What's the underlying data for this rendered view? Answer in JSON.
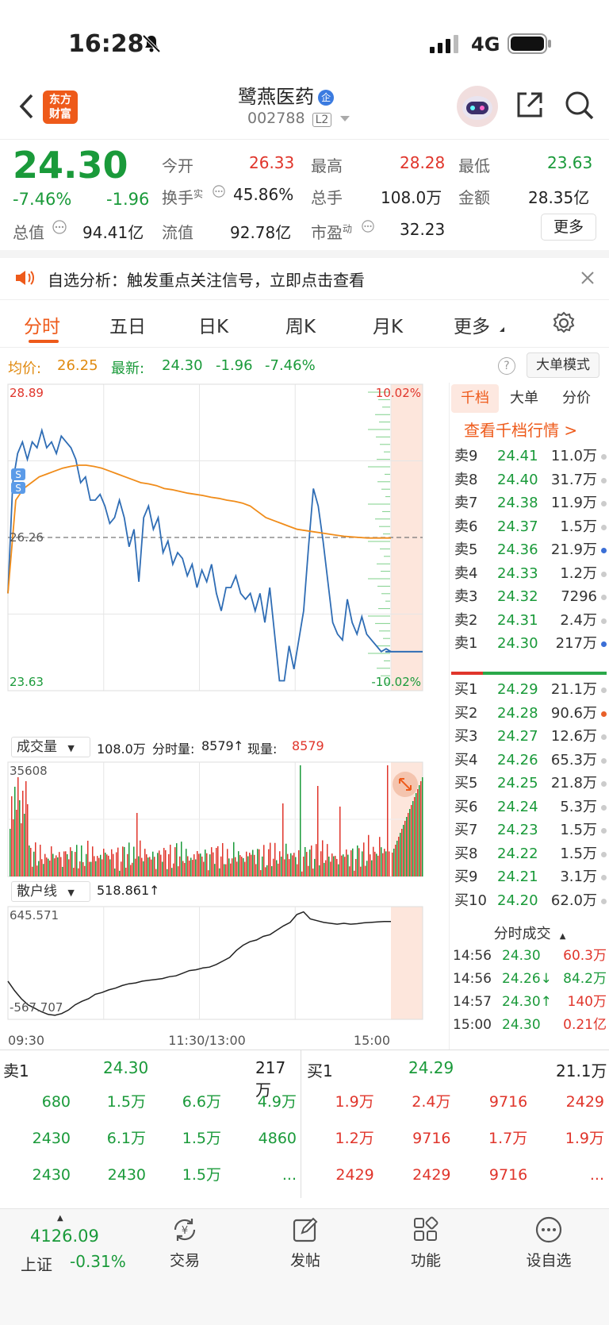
{
  "status_bar": {
    "time": "16:28",
    "network": "4G"
  },
  "header": {
    "logo_line1": "东方",
    "logo_line2": "财富",
    "stock_name": "鹭燕医药",
    "enterprise_badge": "企",
    "stock_code": "002788",
    "level": "L2"
  },
  "quote": {
    "price": "24.30",
    "change_pct": "-7.46%",
    "change": "-1.96",
    "open_label": "今开",
    "open": "26.33",
    "high_label": "最高",
    "high": "28.28",
    "low_label": "最低",
    "low": "23.63",
    "turnover_label": "换手",
    "turnover_sup": "实",
    "turnover": "45.86%",
    "volume_label": "总手",
    "volume": "108.0万",
    "amount_label": "金额",
    "amount": "28.35亿",
    "mktcap_label": "总值",
    "mktcap": "94.41亿",
    "float_label": "流值",
    "float": "92.78亿",
    "pe_label": "市盈",
    "pe_sup": "动",
    "pe": "32.23",
    "more_button": "更多"
  },
  "notice": {
    "text": "自选分析：触发重点关注信号，立即点击查看"
  },
  "tabs": [
    "分时",
    "五日",
    "日K",
    "周K",
    "月K",
    "更多"
  ],
  "active_tab": 0,
  "info_line": {
    "avg_label": "均价:",
    "avg": "26.25",
    "last_label": "最新:",
    "last": "24.30",
    "change": "-1.96",
    "change_pct": "-7.46%",
    "mode_button": "大单模式"
  },
  "chart_data": [
    {
      "type": "line",
      "title": "分时",
      "y_top_label": "28.89",
      "y_bottom_label": "23.63",
      "y_mid_label": "26.26",
      "pct_top_label": "10.02%",
      "pct_bottom_label": "-10.02%",
      "ylim": [
        23.63,
        28.89
      ],
      "reference_price": 26.26,
      "x_labels": [
        "09:30",
        "11:30/13:00",
        "15:00"
      ],
      "series": [
        {
          "name": "",
          "color": "#2f6db5",
          "values": [
            25.3,
            27.2,
            27.7,
            27.9,
            27.6,
            27.9,
            27.8,
            28.1,
            27.8,
            27.9,
            27.7,
            28.0,
            27.9,
            27.8,
            27.6,
            27.2,
            27.3,
            26.9,
            26.9,
            27.0,
            26.8,
            26.5,
            26.6,
            26.9,
            26.6,
            26.1,
            26.4,
            25.5,
            26.6,
            26.8,
            26.4,
            26.6,
            26.0,
            26.2,
            25.8,
            26.0,
            25.9,
            25.6,
            25.8,
            25.4,
            25.7,
            25.5,
            25.8,
            25.3,
            25.0,
            25.4,
            25.4,
            25.6,
            25.3,
            25.2,
            25.3,
            25.0,
            25.3,
            24.8,
            25.4,
            24.6,
            23.8,
            23.8,
            24.4,
            24.0,
            24.5,
            25.0,
            26.1,
            27.1,
            26.8,
            26.2,
            25.5,
            24.8,
            24.6,
            24.5,
            25.2,
            24.8,
            24.6,
            24.9,
            24.6,
            24.5,
            24.4,
            24.3,
            24.35,
            24.3
          ]
        },
        {
          "name": "",
          "color": "#f08c1a",
          "values": [
            25.3,
            26.9,
            27.1,
            27.2,
            27.3,
            27.35,
            27.4,
            27.45,
            27.48,
            27.5,
            27.5,
            27.48,
            27.45,
            27.4,
            27.35,
            27.3,
            27.25,
            27.2,
            27.18,
            27.15,
            27.1,
            27.08,
            27.05,
            27.02,
            27.0,
            26.98,
            26.95,
            26.93,
            26.9,
            26.88,
            26.85,
            26.8,
            26.7,
            26.6,
            26.55,
            26.5,
            26.45,
            26.4,
            26.38,
            26.36,
            26.34,
            26.32,
            26.3,
            26.28,
            26.27,
            26.26,
            26.25,
            26.25,
            26.25,
            26.25
          ]
        }
      ]
    },
    {
      "type": "bar",
      "title": "成交量",
      "summary": "108.0万",
      "minute_label": "分时量:",
      "minute_value": "8579",
      "current_label": "现量:",
      "current_value": "8579",
      "ymax_label": "35608"
    },
    {
      "type": "line",
      "title": "散户线",
      "summary": "518.861",
      "ymax_label": "645.571",
      "ymin_label": "-567.707",
      "ylim": [
        -567.707,
        645.571
      ],
      "series": [
        {
          "name": "",
          "color": "#222",
          "values": [
            -150,
            -260,
            -350,
            -420,
            -460,
            -500,
            -530,
            -540,
            -520,
            -480,
            -420,
            -380,
            -350,
            -300,
            -280,
            -250,
            -230,
            -200,
            -180,
            -170,
            -150,
            -140,
            -130,
            -120,
            -100,
            -90,
            -60,
            -30,
            -20,
            0,
            10,
            40,
            80,
            120,
            200,
            260,
            300,
            320,
            360,
            380,
            430,
            480,
            520,
            610,
            640,
            560,
            540,
            520,
            510,
            500,
            510,
            500,
            505,
            515,
            520,
            525,
            530,
            530
          ]
        }
      ]
    }
  ],
  "side_panel": {
    "tabs": [
      "千档",
      "大单",
      "分价"
    ],
    "link": "查看千档行情 >",
    "asks": [
      {
        "label": "卖9",
        "price": "24.41",
        "vol": "11.0万",
        "dot": "gray"
      },
      {
        "label": "卖8",
        "price": "24.40",
        "vol": "31.7万",
        "dot": "gray"
      },
      {
        "label": "卖7",
        "price": "24.38",
        "vol": "11.9万",
        "dot": "gray"
      },
      {
        "label": "卖6",
        "price": "24.37",
        "vol": "1.5万",
        "dot": "gray"
      },
      {
        "label": "卖5",
        "price": "24.36",
        "vol": "21.9万",
        "dot": "blue"
      },
      {
        "label": "卖4",
        "price": "24.33",
        "vol": "1.2万",
        "dot": "gray"
      },
      {
        "label": "卖3",
        "price": "24.32",
        "vol": "7296",
        "dot": "gray"
      },
      {
        "label": "卖2",
        "price": "24.31",
        "vol": "2.4万",
        "dot": "gray"
      },
      {
        "label": "卖1",
        "price": "24.30",
        "vol": "217万",
        "dot": "blue"
      }
    ],
    "bids": [
      {
        "label": "买1",
        "price": "24.29",
        "vol": "21.1万",
        "dot": "gray"
      },
      {
        "label": "买2",
        "price": "24.28",
        "vol": "90.6万",
        "dot": "orange"
      },
      {
        "label": "买3",
        "price": "24.27",
        "vol": "12.6万",
        "dot": "gray"
      },
      {
        "label": "买4",
        "price": "24.26",
        "vol": "65.3万",
        "dot": "gray"
      },
      {
        "label": "买5",
        "price": "24.25",
        "vol": "21.8万",
        "dot": "gray"
      },
      {
        "label": "买6",
        "price": "24.24",
        "vol": "5.3万",
        "dot": "gray"
      },
      {
        "label": "买7",
        "price": "24.23",
        "vol": "1.5万",
        "dot": "gray"
      },
      {
        "label": "买8",
        "price": "24.22",
        "vol": "1.5万",
        "dot": "gray"
      },
      {
        "label": "买9",
        "price": "24.21",
        "vol": "3.1万",
        "dot": "gray"
      },
      {
        "label": "买10",
        "price": "24.20",
        "vol": "62.0万",
        "dot": "gray"
      }
    ],
    "trades_title": "分时成交",
    "trades": [
      {
        "time": "14:56",
        "price": "24.30",
        "arrow": "",
        "vol": "60.3万",
        "color": "red"
      },
      {
        "time": "14:56",
        "price": "24.26",
        "arrow": "↓",
        "vol": "84.2万",
        "color": "green"
      },
      {
        "time": "14:57",
        "price": "24.30",
        "arrow": "↑",
        "vol": "140万",
        "color": "red"
      },
      {
        "time": "15:00",
        "price": "24.30",
        "arrow": "",
        "vol": "0.21亿",
        "color": "red"
      }
    ]
  },
  "queue": {
    "sell": {
      "label": "卖1",
      "price": "24.30",
      "vol": "217万",
      "rows": [
        [
          "680",
          "1.5万",
          "6.6万",
          "4.9万"
        ],
        [
          "2430",
          "6.1万",
          "1.5万",
          "4860"
        ],
        [
          "2430",
          "2430",
          "1.5万",
          "..."
        ]
      ]
    },
    "buy": {
      "label": "买1",
      "price": "24.29",
      "vol": "21.1万",
      "rows": [
        [
          "1.9万",
          "2.4万",
          "9716",
          "2429"
        ],
        [
          "1.2万",
          "9716",
          "1.7万",
          "1.9万"
        ],
        [
          "2429",
          "2429",
          "9716",
          "..."
        ]
      ]
    }
  },
  "bottom_nav": {
    "index_value": "4126.09",
    "index_name": "上证",
    "index_change": "-0.31%",
    "items": [
      "交易",
      "发帖",
      "功能",
      "设自选"
    ]
  },
  "colors": {
    "up": "#e0352b",
    "down": "#1a9a3a",
    "accent": "#ee5a1a",
    "price_line": "#2f6db5",
    "avg_line": "#f08c1a"
  }
}
